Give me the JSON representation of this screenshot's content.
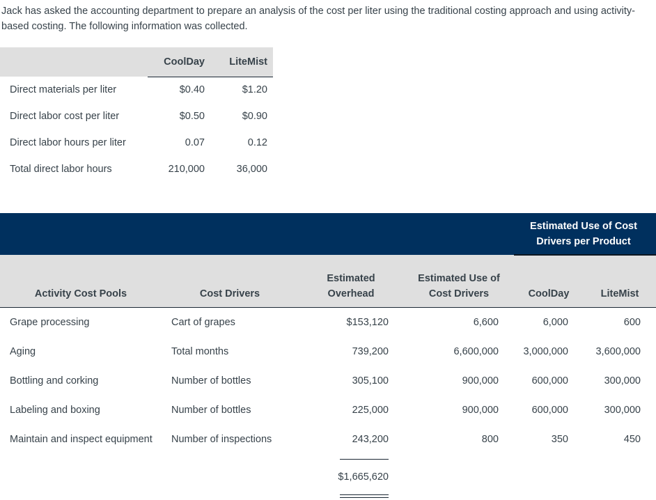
{
  "intro": {
    "paragraph": "Jack has asked the accounting department to prepare an analysis of the cost per liter using the traditional costing approach and using activity-based costing. The following information was collected."
  },
  "table1": {
    "columns": [
      "",
      "CoolDay",
      "LiteMist"
    ],
    "rows": [
      {
        "label": "Direct materials per liter",
        "coolday": "$0.40",
        "litemist": "$1.20"
      },
      {
        "label": "Direct labor cost per liter",
        "coolday": "$0.50",
        "litemist": "$0.90"
      },
      {
        "label": "Direct labor hours per liter",
        "coolday": "0.07",
        "litemist": "0.12"
      },
      {
        "label": "Total direct labor hours",
        "coolday": "210,000",
        "litemist": "36,000"
      }
    ]
  },
  "table2": {
    "banner_title": "Estimated Use of Cost Drivers per Product",
    "banner_color": "#00305e",
    "header_bg": "#dfdfdf",
    "columns": {
      "activity_cost_pools": "Activity Cost Pools",
      "cost_drivers": "Cost Drivers",
      "estimated_overhead": "Estimated Overhead",
      "estimated_use_of_cost_drivers": "Estimated Use of Cost Drivers",
      "coolday": "CoolDay",
      "litemist": "LiteMist"
    },
    "rows": [
      {
        "activity": "Grape processing",
        "driver": "Cart of grapes",
        "overhead": "$153,120",
        "use_of_drivers": "6,600",
        "coolday": "6,000",
        "litemist": "600"
      },
      {
        "activity": "Aging",
        "driver": "Total months",
        "overhead": "739,200",
        "use_of_drivers": "6,600,000",
        "coolday": "3,000,000",
        "litemist": "3,600,000"
      },
      {
        "activity": "Bottling and corking",
        "driver": "Number of bottles",
        "overhead": "305,100",
        "use_of_drivers": "900,000",
        "coolday": "600,000",
        "litemist": "300,000"
      },
      {
        "activity": "Labeling and boxing",
        "driver": "Number of bottles",
        "overhead": "225,000",
        "use_of_drivers": "900,000",
        "coolday": "600,000",
        "litemist": "300,000"
      },
      {
        "activity": "Maintain and inspect equipment",
        "driver": "Number of inspections",
        "overhead": "243,200",
        "use_of_drivers": "800",
        "coolday": "350",
        "litemist": "450"
      }
    ],
    "total_overhead": "$1,665,620"
  }
}
